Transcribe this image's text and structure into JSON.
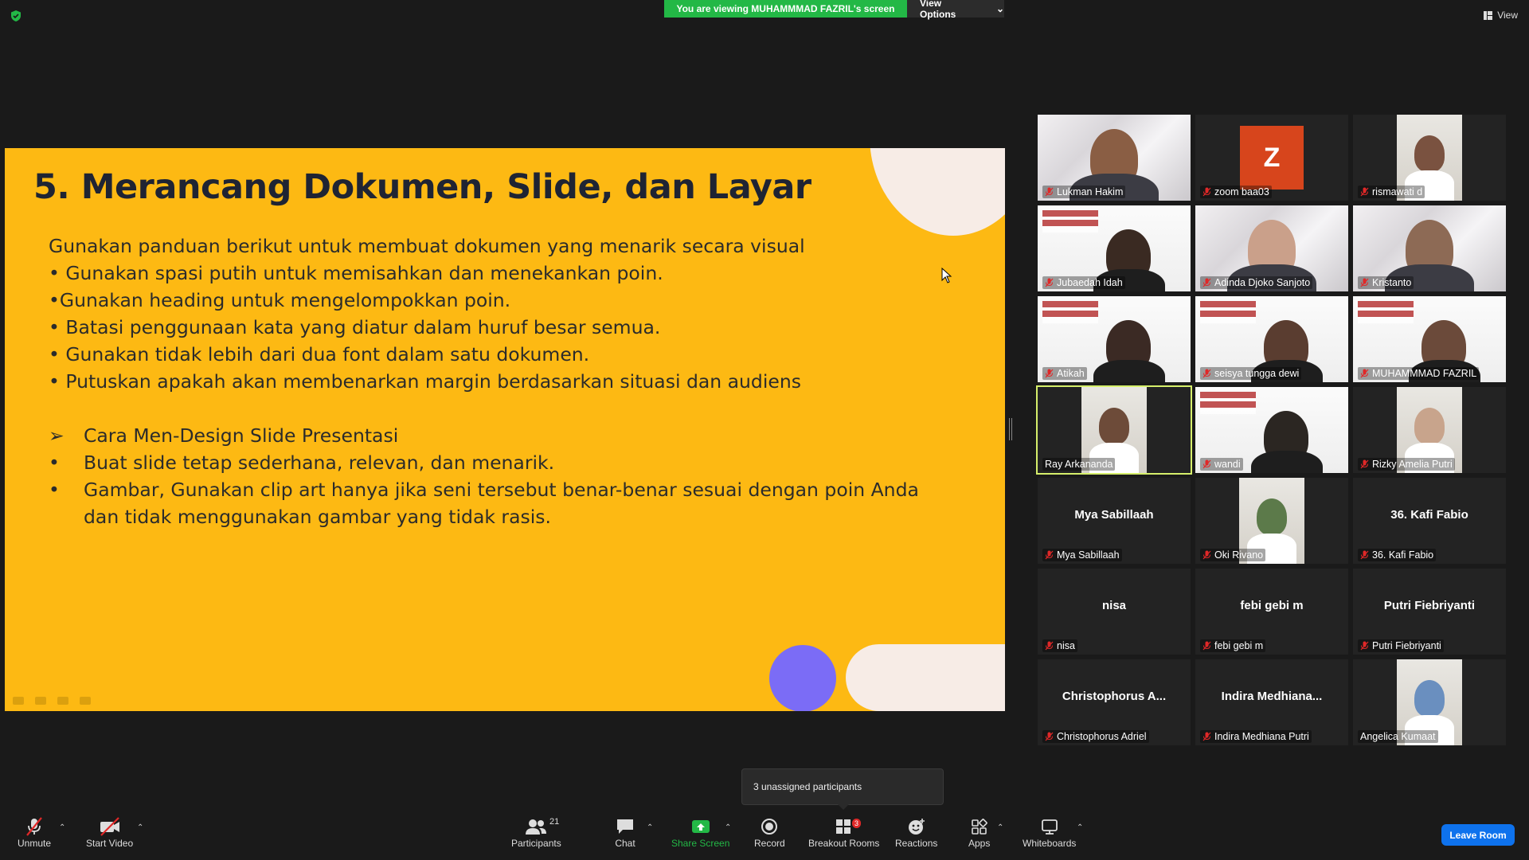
{
  "top": {
    "viewing_banner": "You are viewing MUHAMMMAD FAZRIL's screen",
    "view_options_label": "View Options",
    "view_label": "View"
  },
  "slide": {
    "title": "5. Merancang Dokumen, Slide, dan Layar",
    "lines": [
      "Gunakan panduan berikut untuk membuat dokumen yang menarik secara visual",
      "• Gunakan spasi putih untuk memisahkan dan menekankan poin.",
      "•Gunakan heading untuk mengelompokkan poin.",
      "• Batasi penggunaan kata yang diatur dalam huruf besar semua.",
      "• Gunakan tidak lebih dari dua font dalam satu dokumen.",
      "• Putuskan apakah akan membenarkan margin berdasarkan situasi dan audiens"
    ],
    "sub_items": [
      {
        "marker": "➢",
        "text": "Cara Men-Design Slide Presentasi"
      },
      {
        "marker": "•",
        "text": "Buat slide tetap sederhana, relevan, dan menarik."
      },
      {
        "marker": "•",
        "text": "Gambar, Gunakan clip art hanya jika seni tersebut benar-benar sesuai dengan poin Anda dan tidak menggunakan gambar yang tidak rasis."
      }
    ]
  },
  "participants": [
    {
      "name": "Lukman Hakim",
      "muted": true
    },
    {
      "name": "zoom baa03",
      "muted": true,
      "avatar_letter": "Z"
    },
    {
      "name": "rismawati d",
      "muted": true
    },
    {
      "name": "Jubaedah Idah",
      "muted": true
    },
    {
      "name": "Adinda Djoko Sanjoto",
      "muted": true
    },
    {
      "name": "Kristanto",
      "muted": true
    },
    {
      "name": "Atikah",
      "muted": true
    },
    {
      "name": "seisya tungga dewi",
      "muted": true
    },
    {
      "name": "MUHAMMMAD FAZRIL",
      "muted": true
    },
    {
      "name": "Ray Arkananda",
      "muted": false,
      "active": true
    },
    {
      "name": "wandi",
      "muted": true
    },
    {
      "name": "Rizky Amelia Putri",
      "muted": true
    },
    {
      "name": "Mya Sabillaah",
      "muted": true,
      "display": "Mya Sabillaah"
    },
    {
      "name": "Oki Rivano",
      "muted": true
    },
    {
      "name": "36. Kafi Fabio",
      "muted": true,
      "display": "36. Kafi Fabio"
    },
    {
      "name": "nisa",
      "muted": true,
      "display": "nisa"
    },
    {
      "name": "febi gebi m",
      "muted": true,
      "display": "febi gebi m"
    },
    {
      "name": "Putri Fiebriyanti",
      "muted": true,
      "display": "Putri Fiebriyanti"
    },
    {
      "name": "Christophorus Adriel",
      "muted": true,
      "display": "Christophorus  A..."
    },
    {
      "name": "Indira Medhiana Putri",
      "muted": true,
      "display": "Indira  Medhiana..."
    },
    {
      "name": "Angelica Kumaat",
      "muted": false
    }
  ],
  "tooltip": "3 unassigned participants",
  "toolbar": {
    "unmute": "Unmute",
    "start_video": "Start Video",
    "participants": "Participants",
    "participants_count": "21",
    "chat": "Chat",
    "share_screen": "Share Screen",
    "record": "Record",
    "breakout_rooms": "Breakout Rooms",
    "breakout_badge": "3",
    "reactions": "Reactions",
    "apps": "Apps",
    "whiteboards": "Whiteboards",
    "leave_room": "Leave Room"
  },
  "colors": {
    "slide_bg": "#fdb913",
    "banner_green": "#23b846",
    "leave_blue": "#0e72ed",
    "active_speaker": "#d6ef6b"
  }
}
